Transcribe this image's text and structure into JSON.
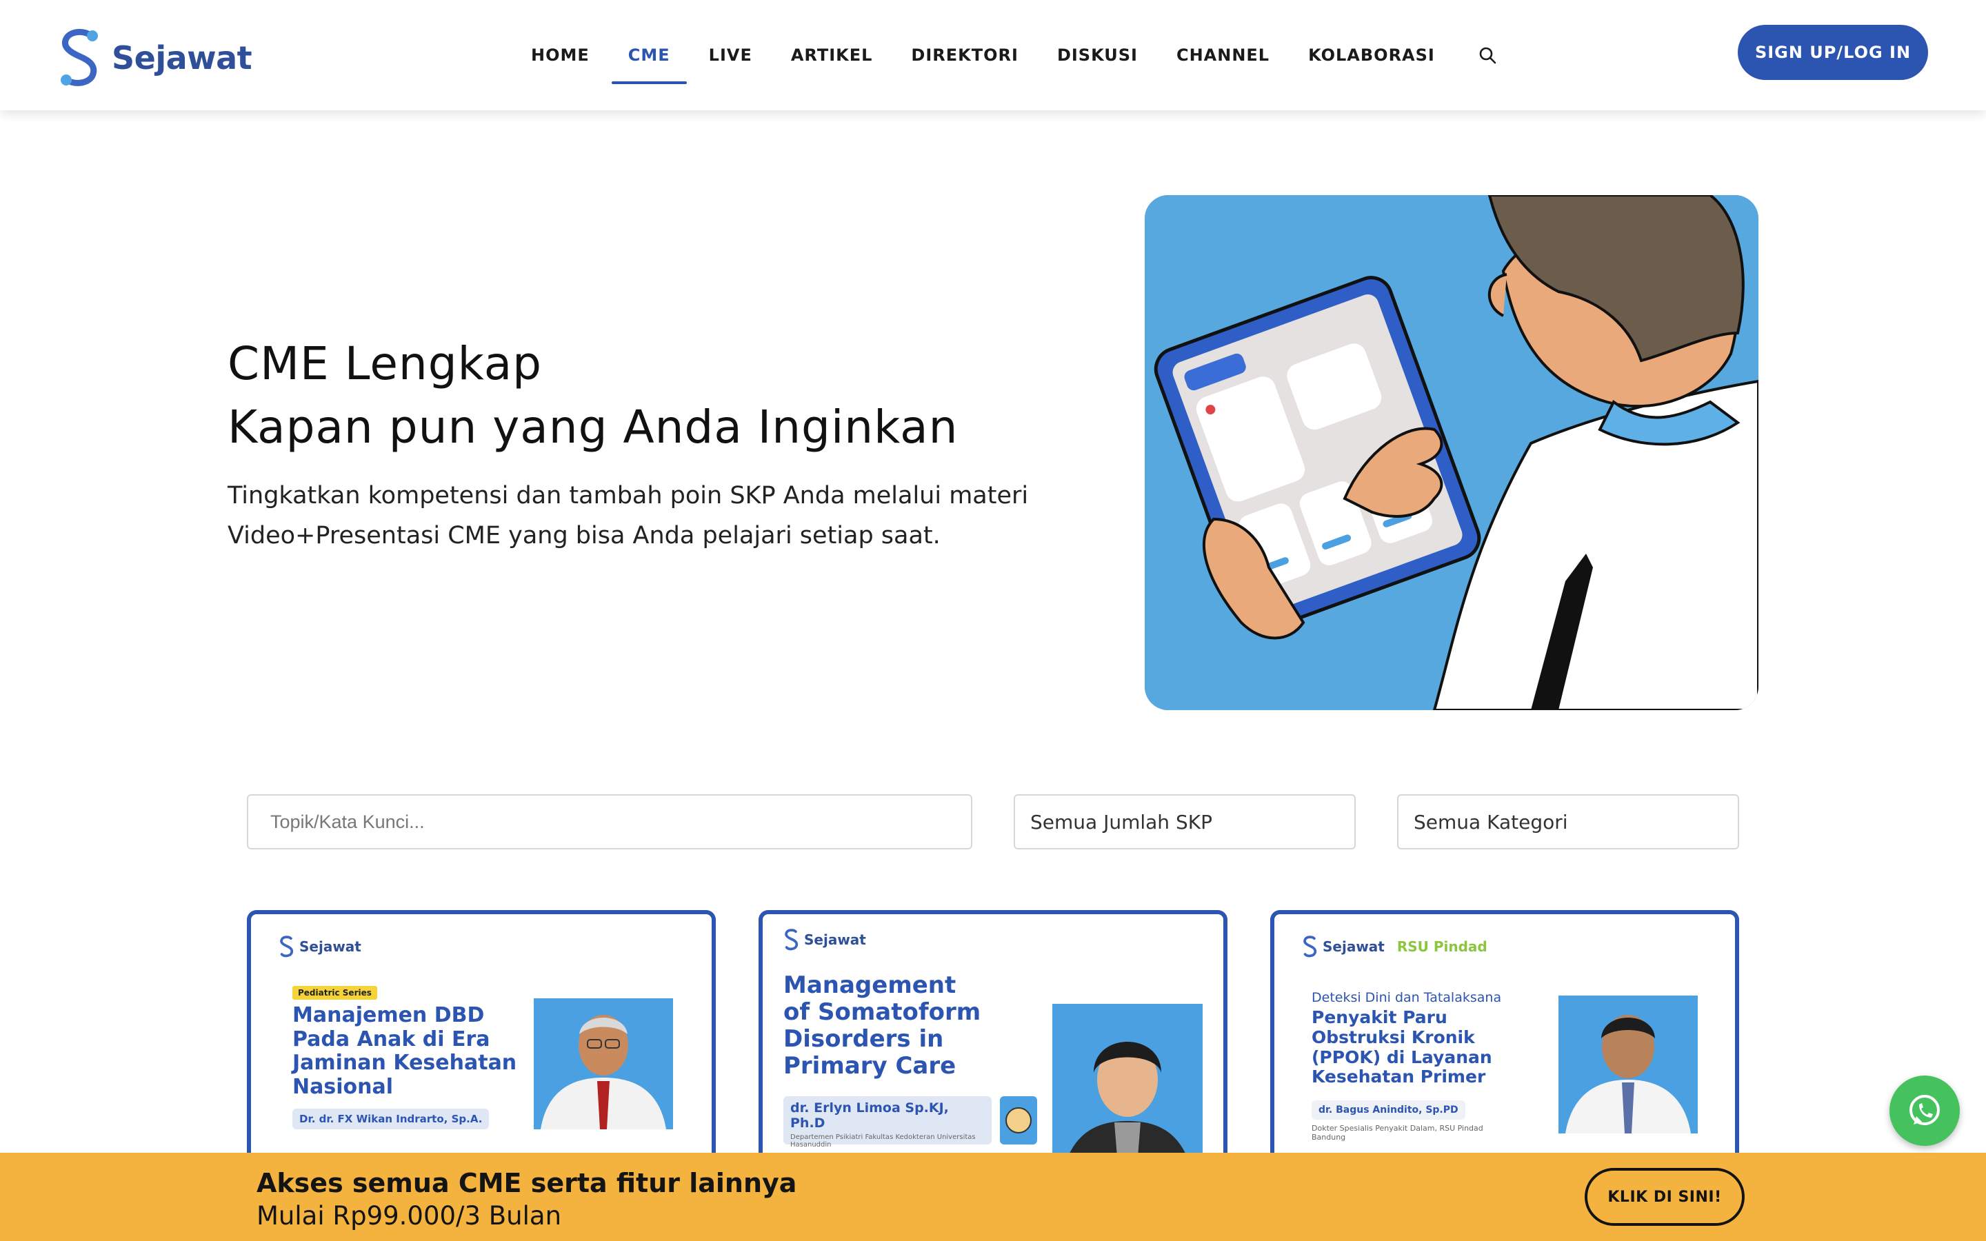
{
  "brand": {
    "name": "Sejawat",
    "primary_color": "#2c54b1",
    "accent_color": "#f4b33f"
  },
  "nav": {
    "items": [
      {
        "label": "HOME",
        "active": false
      },
      {
        "label": "CME",
        "active": true
      },
      {
        "label": "LIVE",
        "active": false
      },
      {
        "label": "ARTIKEL",
        "active": false
      },
      {
        "label": "DIREKTORI",
        "active": false
      },
      {
        "label": "DISKUSI",
        "active": false
      },
      {
        "label": "CHANNEL",
        "active": false
      },
      {
        "label": "KOLABORASI",
        "active": false
      }
    ],
    "search_icon": "search-icon",
    "signup_label": "SIGN UP/LOG IN"
  },
  "hero": {
    "title_line1": "CME Lengkap",
    "title_line2": "Kapan pun yang Anda Inginkan",
    "subtitle": "Tingkatkan kompetensi dan tambah poin SKP Anda melalui materi Video+Presentasi CME yang bisa Anda pelajari setiap saat."
  },
  "filters": {
    "search_placeholder": "Topik/Kata Kunci...",
    "skp_value": "Semua Jumlah SKP",
    "category_value": "Semua Kategori"
  },
  "cards": [
    {
      "logo": "Sejawat",
      "series": "Pediatric Series",
      "title": "Manajemen DBD Pada Anak di Era Jaminan Kesehatan Nasional",
      "doctor": "Dr. dr. FX Wikan Indrarto, Sp.A."
    },
    {
      "logo": "Sejawat",
      "title": "Management of Somatoform Disorders in Primary Care",
      "doctor": "dr. Erlyn Limoa Sp.KJ, Ph.D",
      "affiliation": "Departemen Psikiatri Fakultas Kedokteran Universitas Hasanuddin"
    },
    {
      "logo": "Sejawat",
      "partner": "RSU Pindad",
      "pre_title": "Deteksi Dini dan Tatalaksana",
      "title": "Penyakit Paru Obstruksi Kronik (PPOK) di Layanan Kesehatan Primer",
      "doctor": "dr. Bagus Anindito, Sp.PD",
      "affiliation": "Dokter Spesialis Penyakit Dalam, RSU Pindad Bandung"
    }
  ],
  "banner": {
    "title": "Akses semua CME serta fitur lainnya",
    "subtitle": "Mulai Rp99.000/3 Bulan",
    "button_label": "KLIK DI SINI!"
  },
  "whatsapp_icon": "whatsapp-icon"
}
